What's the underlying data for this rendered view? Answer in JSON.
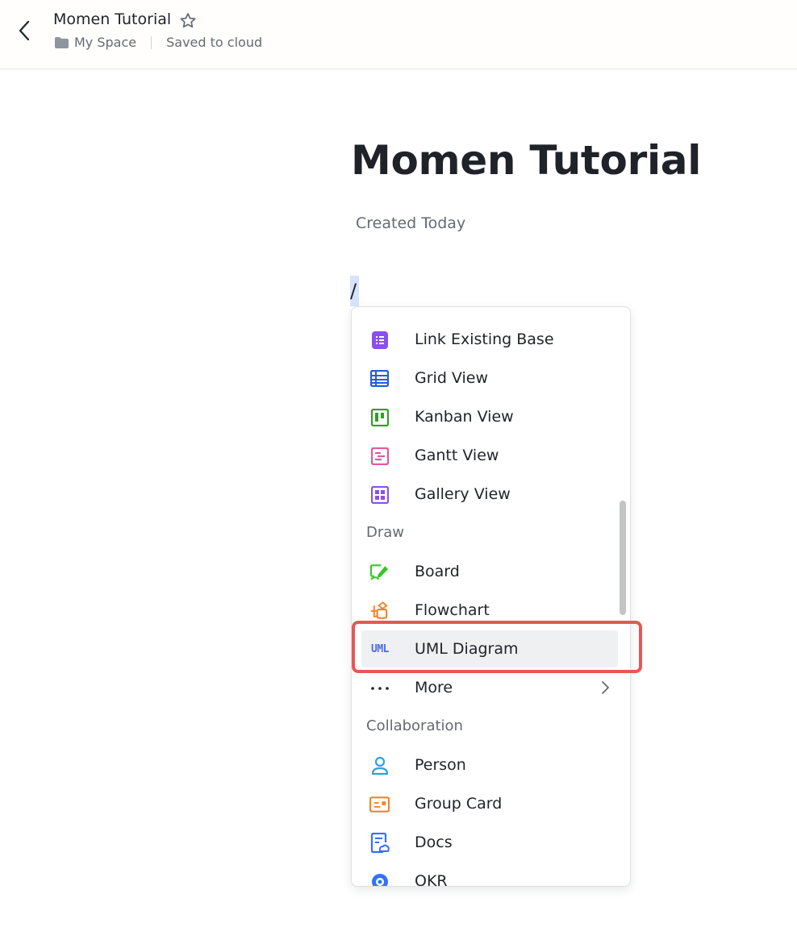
{
  "header": {
    "title": "Momen Tutorial",
    "breadcrumb_space": "My Space",
    "save_status": "Saved to cloud"
  },
  "document": {
    "title": "Momen Tutorial",
    "created": "Created Today",
    "slash_text": "/"
  },
  "menu": {
    "items": [
      {
        "label": "Link Existing Base",
        "icon": "link-base-icon",
        "color": "#8a4fec"
      },
      {
        "label": "Grid View",
        "icon": "grid-view-icon",
        "color": "#245bdb"
      },
      {
        "label": "Kanban View",
        "icon": "kanban-view-icon",
        "color": "#2ea121"
      },
      {
        "label": "Gantt View",
        "icon": "gantt-view-icon",
        "color": "#e0599a"
      },
      {
        "label": "Gallery View",
        "icon": "gallery-view-icon",
        "color": "#8a4fec"
      }
    ],
    "draw_section": "Draw",
    "draw_items": [
      {
        "label": "Board",
        "icon": "board-icon",
        "color": "#34c724"
      },
      {
        "label": "Flowchart",
        "icon": "flowchart-icon",
        "color": "#f5812c"
      },
      {
        "label": "UML Diagram",
        "icon": "uml-icon",
        "icon_text": "UML",
        "color": "#4a6bf0"
      },
      {
        "label": "More",
        "icon": "more-icon"
      }
    ],
    "collab_section": "Collaboration",
    "collab_items": [
      {
        "label": "Person",
        "icon": "person-icon",
        "color": "#2ca2e0"
      },
      {
        "label": "Group Card",
        "icon": "group-card-icon",
        "color": "#f5812c"
      },
      {
        "label": "Docs",
        "icon": "docs-icon",
        "color": "#3370ff"
      },
      {
        "label": "OKR",
        "icon": "okr-icon",
        "color": "#3370ff"
      }
    ]
  },
  "colors": {
    "highlight": "#e85656",
    "selected_bg": "#eff0f1",
    "text": "#1f2329",
    "secondary_text": "#646a73"
  }
}
